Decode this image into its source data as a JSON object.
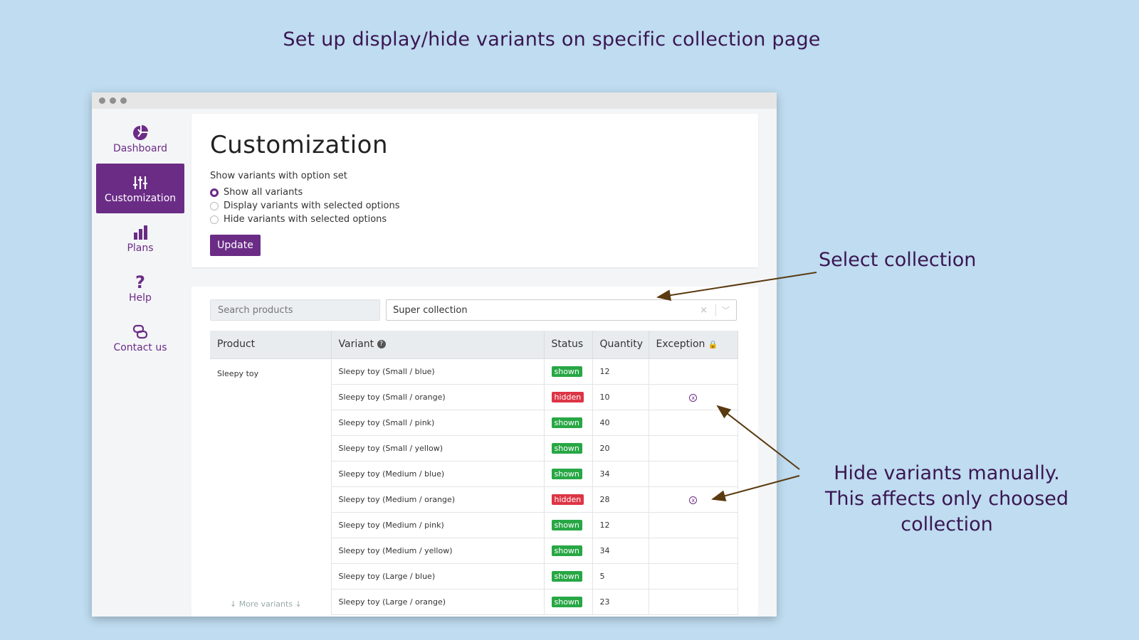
{
  "headline": "Set up display/hide variants on specific collection page",
  "callouts": {
    "select_collection": "Select collection",
    "hide_line1": "Hide variants manually.",
    "hide_line2": "This affects only choosed collection"
  },
  "colors": {
    "accent": "#6b2c86",
    "shown": "#28a745",
    "hidden": "#dc3545",
    "background": "#bfdcf0"
  },
  "sidebar": {
    "items": [
      {
        "label": "Dashboard",
        "icon": "pie-chart-icon",
        "active": false
      },
      {
        "label": "Customization",
        "icon": "sliders-icon",
        "active": true
      },
      {
        "label": "Plans",
        "icon": "bar-chart-icon",
        "active": false
      },
      {
        "label": "Help",
        "icon": "question-icon",
        "active": false
      },
      {
        "label": "Contact us",
        "icon": "chat-icon",
        "active": false
      }
    ]
  },
  "customization": {
    "title": "Customization",
    "subtitle": "Show variants with option set",
    "options": [
      {
        "label": "Show all variants",
        "selected": true
      },
      {
        "label": "Display variants with selected options",
        "selected": false
      },
      {
        "label": "Hide variants with selected options",
        "selected": false
      }
    ],
    "update_label": "Update"
  },
  "filters": {
    "search_placeholder": "Search products",
    "collection_value": "Super collection",
    "clear_glyph": "×",
    "dropdown_glyph": "﹀"
  },
  "table": {
    "headers": {
      "product": "Product",
      "variant": "Variant",
      "status": "Status",
      "quantity": "Quantity",
      "exception": "Exception"
    },
    "product_name": "Sleepy toy",
    "more_variants": "↓ More variants ↓",
    "rows": [
      {
        "variant": "Sleepy toy (Small / blue)",
        "status": "shown",
        "quantity": "12",
        "exception": ""
      },
      {
        "variant": "Sleepy toy (Small / orange)",
        "status": "hidden",
        "quantity": "10",
        "exception": "x"
      },
      {
        "variant": "Sleepy toy (Small / pink)",
        "status": "shown",
        "quantity": "40",
        "exception": ""
      },
      {
        "variant": "Sleepy toy (Small / yellow)",
        "status": "shown",
        "quantity": "20",
        "exception": ""
      },
      {
        "variant": "Sleepy toy (Medium / blue)",
        "status": "shown",
        "quantity": "34",
        "exception": ""
      },
      {
        "variant": "Sleepy toy (Medium / orange)",
        "status": "hidden",
        "quantity": "28",
        "exception": "x"
      },
      {
        "variant": "Sleepy toy (Medium / pink)",
        "status": "shown",
        "quantity": "12",
        "exception": ""
      },
      {
        "variant": "Sleepy toy (Medium / yellow)",
        "status": "shown",
        "quantity": "34",
        "exception": ""
      },
      {
        "variant": "Sleepy toy (Large / blue)",
        "status": "shown",
        "quantity": "5",
        "exception": ""
      },
      {
        "variant": "Sleepy toy (Large / orange)",
        "status": "shown",
        "quantity": "23",
        "exception": ""
      }
    ]
  }
}
